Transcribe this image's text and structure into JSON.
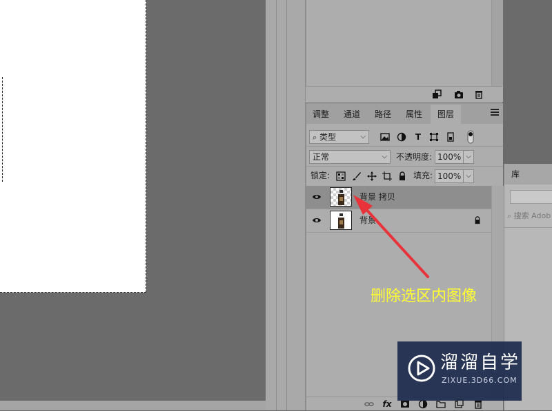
{
  "tabs": [
    {
      "label": "调整"
    },
    {
      "label": "通道"
    },
    {
      "label": "路径"
    },
    {
      "label": "属性"
    },
    {
      "label": "图层"
    }
  ],
  "active_tab": "图层",
  "filter": {
    "kind_label": "类型"
  },
  "blend": {
    "mode": "正常",
    "opacity_label": "不透明度:",
    "opacity_value": "100%"
  },
  "lock": {
    "label": "锁定:",
    "fill_label": "填充:",
    "fill_value": "100%"
  },
  "layers": [
    {
      "name": "背景 拷贝",
      "selected": true,
      "visible": true,
      "locked": false
    },
    {
      "name": "背景",
      "selected": false,
      "visible": true,
      "locked": true
    }
  ],
  "library": {
    "title": "库",
    "search_placeholder": "搜索 Adob"
  },
  "annotation": {
    "text": "删除选区内图像",
    "color": "#ffff33"
  },
  "watermark": {
    "title": "溜溜自学",
    "url": "ZIXUE.3D66.COM"
  },
  "colors": {
    "accent_arrow": "#e8333a",
    "selected_layer": "#8e8e8e",
    "panel_bg": "#adadad"
  },
  "icons": {
    "footer_upper": [
      "new-snapshot-icon",
      "camera-icon",
      "trash-icon"
    ],
    "filter": [
      "image-filter-icon",
      "adjustment-filter-icon",
      "type-filter-icon",
      "shape-filter-icon",
      "smart-object-filter-icon",
      "filter-toggle-icon"
    ],
    "lock": [
      "lock-transparent-icon",
      "lock-paint-icon",
      "lock-position-icon",
      "lock-artboard-icon",
      "lock-all-icon"
    ],
    "footer_layers": [
      "link-icon",
      "fx-icon",
      "mask-icon",
      "adjustment-layer-icon",
      "group-icon",
      "new-layer-icon",
      "trash-icon"
    ]
  }
}
